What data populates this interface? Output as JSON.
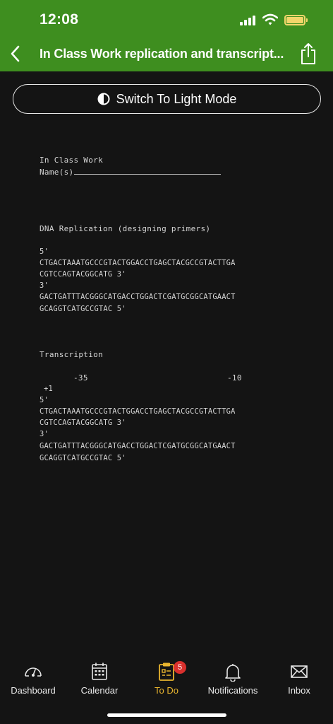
{
  "status": {
    "time": "12:08"
  },
  "header": {
    "title": "In Class Work replication and transcript..."
  },
  "mode_button": {
    "label": "Switch To Light Mode"
  },
  "document": {
    "heading": "In Class Work",
    "names_label": "Name(s)",
    "section1_title": "DNA Replication (designing primers)",
    "section1_five": "5'",
    "section1_top_a": "CTGACTAAATGCCCGTACTGGACCTGAGCTACGCCGTACTTGA",
    "section1_top_b": "CGTCCAGTACGGCATG 3'",
    "section1_three": "3'",
    "section1_bot_a": "GACTGATTTACGGGCATGACCTGGACTCGATGCGGCATGAACT",
    "section1_bot_b": "GCAGGTCATGCCGTAC 5'",
    "section2_title": "Transcription",
    "minus35": "-35",
    "minus10": "-10",
    "plus1": "+1",
    "section2_five": "5'",
    "section2_top_a": "CTGACTAAATGCCCGTACTGGACCTGAGCTACGCCGTACTTGA",
    "section2_top_b": "CGTCCAGTACGGCATG 3'",
    "section2_three": "3'",
    "section2_bot_a": "GACTGATTTACGGGCATGACCTGGACTCGATGCGGCATGAACT",
    "section2_bot_b": "GCAGGTCATGCCGTAC 5'"
  },
  "tabs": [
    {
      "label": "Dashboard",
      "icon": "dashboard-gauge-icon"
    },
    {
      "label": "Calendar",
      "icon": "calendar-icon"
    },
    {
      "label": "To Do",
      "icon": "todo-clipboard-icon",
      "badge": "5",
      "active": true
    },
    {
      "label": "Notifications",
      "icon": "bell-icon"
    },
    {
      "label": "Inbox",
      "icon": "envelope-icon"
    }
  ],
  "colors": {
    "header_green": "#3e8e1f",
    "active_tab": "#e9b52f",
    "badge_red": "#d9302d",
    "background": "#141414"
  }
}
